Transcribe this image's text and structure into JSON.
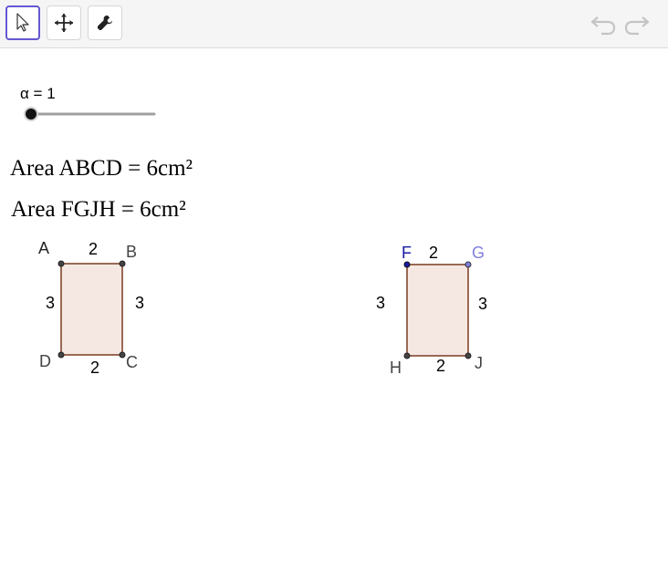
{
  "toolbar": {
    "tools": [
      {
        "icon": "pointer-arrow-icon",
        "active": true
      },
      {
        "icon": "move-graphics-icon",
        "active": false
      },
      {
        "icon": "wrench-icon",
        "active": false
      }
    ],
    "undo_icon": "undo-icon",
    "redo_icon": "redo-icon"
  },
  "slider": {
    "label": "α = 1",
    "value": 1,
    "position_fraction": 0
  },
  "texts": {
    "area_abcd": "Area ABCD = 6cm²",
    "area_fgjh": "Area FGJH = 6cm²"
  },
  "rect_abcd": {
    "vertices": {
      "A": "A",
      "B": "B",
      "C": "C",
      "D": "D"
    },
    "top_len": "2",
    "bottom_len": "2",
    "left_len": "3",
    "right_len": "3"
  },
  "rect_fgjh": {
    "vertices": {
      "F": "F",
      "G": "G",
      "H": "H",
      "J": "J"
    },
    "top_len": "2",
    "bottom_len": "2",
    "left_len": "3",
    "right_len": "3"
  },
  "colors": {
    "accent": "#6557d2",
    "rect_fill": "#f5e8e3",
    "rect_stroke": "#7a3b1e",
    "point_F": "#1a1aa6",
    "point_G": "#7f7fe0",
    "vertex_label": "#444444"
  }
}
